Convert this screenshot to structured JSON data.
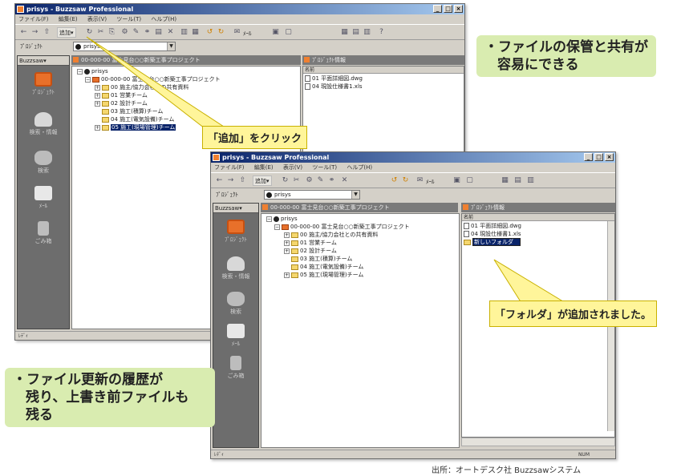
{
  "window_back": {
    "title": "prisys - Buzzsaw Professional",
    "menu": [
      "ファイル(F)",
      "編集(E)",
      "表示(V)",
      "ツール(T)",
      "ヘルプ(H)"
    ],
    "add_button": "追加▾",
    "toolbar_right": "ﾒｰﾙ",
    "project_label": "ﾌﾟﾛｼﾞｪｸﾄ",
    "project_value": "prisys",
    "sidebar_header": "Buzzsaw▾",
    "sidebar_items": [
      "ﾌﾟﾛｼﾞｪｸﾄ",
      "検索・情報",
      "検索",
      "ﾒｰﾙ",
      "ごみ箱"
    ],
    "tree_panel_title": "00-000-00 富士見台○○新築工事プロジェクト",
    "file_panel_title": "ﾌﾟﾛｼﾞｪｸﾄ情報",
    "tree": [
      "prisys",
      "00-000-00 富士見台○○新築工事プロジェクト",
      "00 施主/協力会社との共有資料",
      "01 営業チーム",
      "02 設計チーム",
      "03 施工(積算)チーム",
      "04 施工(電気設備)チーム",
      "05 施工(現場管理)チーム"
    ],
    "file_header": "名前",
    "files": [
      "01 平面詳細図.dwg",
      "04 現設仕様書1.xls"
    ],
    "status": "ﾚﾃﾞｨ"
  },
  "window_front": {
    "title": "prisys - Buzzsaw Professional",
    "menu": [
      "ファイル(F)",
      "編集(E)",
      "表示(V)",
      "ツール(T)",
      "ヘルプ(H)"
    ],
    "add_button": "追加▾",
    "toolbar_right": "ﾒｰﾙ",
    "project_label": "ﾌﾟﾛｼﾞｪｸﾄ",
    "project_value": "prisys",
    "sidebar_header": "Buzzsaw▾",
    "sidebar_items": [
      "ﾌﾟﾛｼﾞｪｸﾄ",
      "検索・情報",
      "検索",
      "ﾒｰﾙ",
      "ごみ箱"
    ],
    "tree_panel_title": "00-000-00 富士見台○○新築工事プロジェクト",
    "file_panel_title": "ﾌﾟﾛｼﾞｪｸﾄ情報",
    "tree": [
      "prisys",
      "00-000-00 富士見台○○新築工事プロジェクト",
      "00 施主/協力会社との共有資料",
      "01 営業チーム",
      "02 設計チーム",
      "03 施工(積算)チーム",
      "04 施工(電気設備)チーム",
      "05 施工(現場管理)チーム"
    ],
    "file_header": "名前",
    "files": [
      "01 平面詳細図.dwg",
      "04 現設仕様書1.xls"
    ],
    "new_folder": "新しいフォルダ",
    "status": "ﾚﾃﾞｨ",
    "status_right": "NUM"
  },
  "callouts": {
    "click_add": "「追加」をクリック",
    "folder_added": "「フォルダ」が追加されました。"
  },
  "notes": {
    "top_right": [
      "・ファイルの保管と共有が",
      "容易にできる"
    ],
    "bottom_left": [
      "・ファイル更新の履歴が",
      "残り、上書き前ファイルも",
      "残る"
    ]
  },
  "source": "出所：オートデスク社 Buzzsawシステム",
  "colors": {
    "title_gradient_start": "#0a246a",
    "callout_fill": "#fff59a",
    "note_fill": "#d9ecb0",
    "sidebar": "#6d6d6d"
  }
}
